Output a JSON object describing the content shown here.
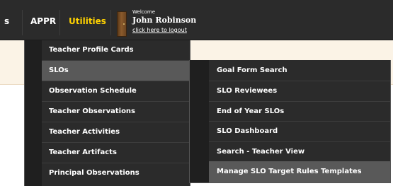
{
  "nav": {
    "items": [
      {
        "label": "s"
      },
      {
        "label": "APPR"
      },
      {
        "label": "Utilities"
      }
    ]
  },
  "user": {
    "welcome": "Welcome",
    "name": "John Robinson",
    "logout": "click here to logout"
  },
  "menu": {
    "items": [
      {
        "label": "Teacher Profile Cards"
      },
      {
        "label": "SLOs"
      },
      {
        "label": "Observation Schedule"
      },
      {
        "label": "Teacher Observations"
      },
      {
        "label": "Teacher Activities"
      },
      {
        "label": "Teacher Artifacts"
      },
      {
        "label": "Principal Observations"
      }
    ]
  },
  "submenu": {
    "items": [
      {
        "label": "Goal Form Search"
      },
      {
        "label": "SLO Reviewees"
      },
      {
        "label": "End of Year SLOs"
      },
      {
        "label": "SLO Dashboard"
      },
      {
        "label": "Search - Teacher View"
      },
      {
        "label": "Manage SLO Target Rules Templates"
      }
    ]
  }
}
